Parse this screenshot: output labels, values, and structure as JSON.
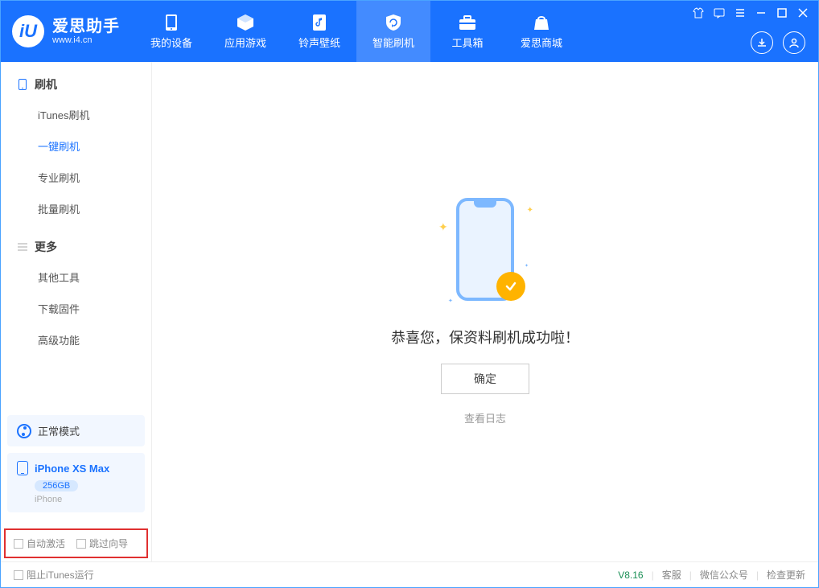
{
  "app": {
    "title": "爱思助手",
    "url": "www.i4.cn"
  },
  "nav": {
    "items": [
      {
        "label": "我的设备"
      },
      {
        "label": "应用游戏"
      },
      {
        "label": "铃声壁纸"
      },
      {
        "label": "智能刷机"
      },
      {
        "label": "工具箱"
      },
      {
        "label": "爱思商城"
      }
    ]
  },
  "sidebar": {
    "sections": [
      {
        "title": "刷机",
        "items": [
          "iTunes刷机",
          "一键刷机",
          "专业刷机",
          "批量刷机"
        ]
      },
      {
        "title": "更多",
        "items": [
          "其他工具",
          "下载固件",
          "高级功能"
        ]
      }
    ],
    "mode": "正常模式",
    "device": {
      "name": "iPhone XS Max",
      "storage": "256GB",
      "type": "iPhone"
    },
    "checkboxes": {
      "auto_activate": "自动激活",
      "skip_guide": "跳过向导"
    }
  },
  "main": {
    "success_message": "恭喜您，保资料刷机成功啦！",
    "ok_button": "确定",
    "view_log": "查看日志"
  },
  "footer": {
    "block_itunes": "阻止iTunes运行",
    "version": "V8.16",
    "links": [
      "客服",
      "微信公众号",
      "检查更新"
    ]
  }
}
